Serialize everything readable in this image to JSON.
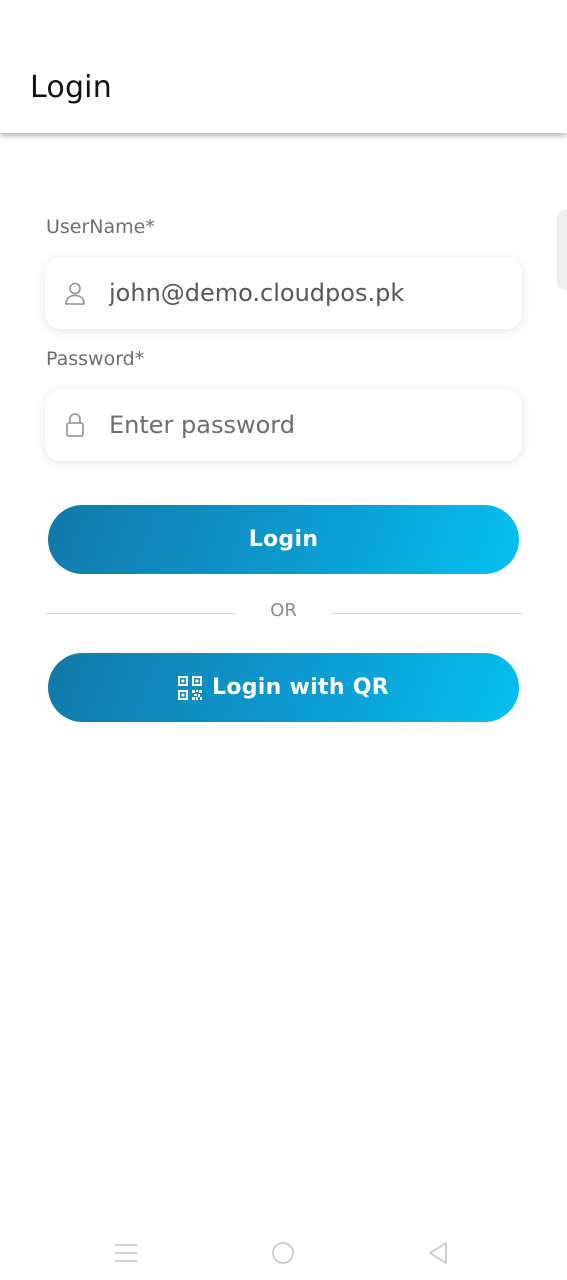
{
  "appbar": {
    "title": "Login"
  },
  "form": {
    "username": {
      "label": "UserName*",
      "value": "john@demo.cloudpos.pk",
      "icon": "user-icon"
    },
    "password": {
      "label": "Password*",
      "placeholder": "Enter password",
      "icon": "lock-icon"
    },
    "login_button": "Login",
    "separator": "OR",
    "qr_button": {
      "label": "Login with QR",
      "icon": "qr-code-icon"
    }
  },
  "theme": {
    "gradient_start": "#1179a8",
    "gradient_end": "#05c0ef"
  },
  "system_nav": {
    "icons": [
      "menu-icon",
      "home-icon",
      "back-icon"
    ]
  }
}
